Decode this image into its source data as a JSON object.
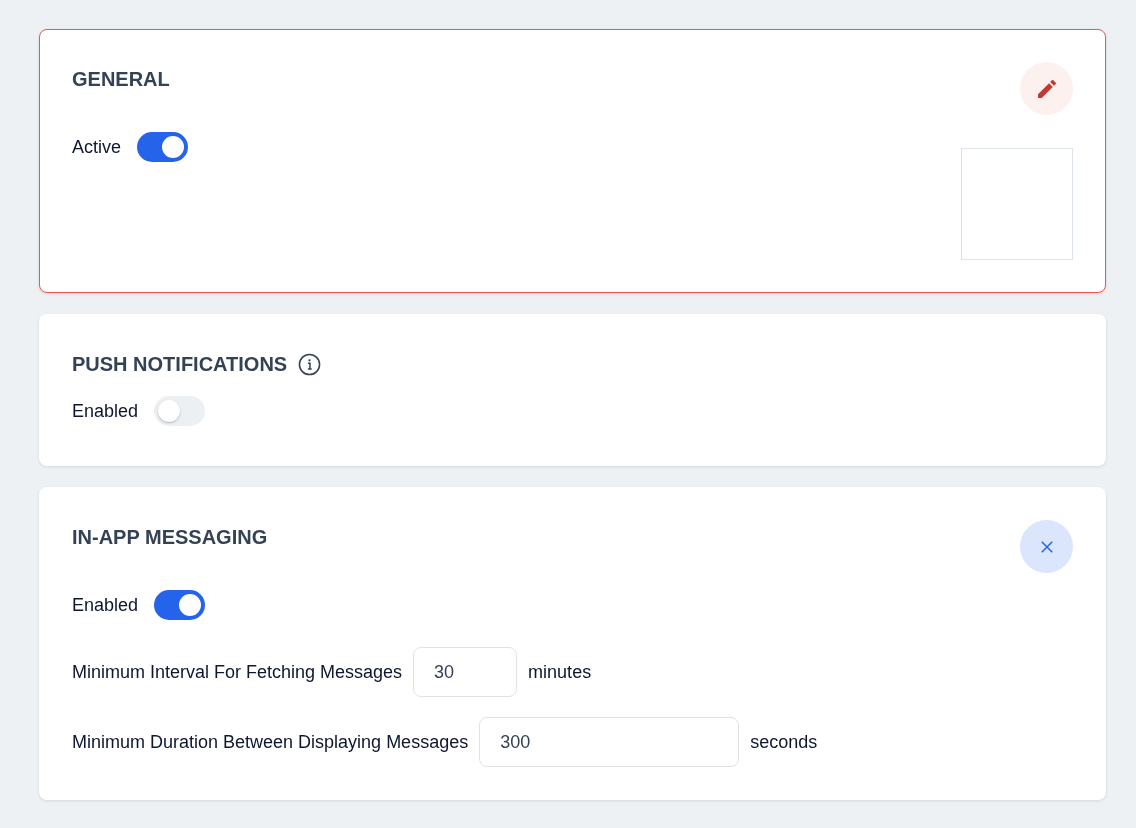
{
  "sections": [
    {
      "title": "GENERAL",
      "selected": true,
      "info_icon": false,
      "edit_button": true,
      "close_button": false,
      "image_frame": true,
      "fields": [
        {
          "kind": "toggle",
          "label": "Active",
          "on": true
        }
      ]
    },
    {
      "title": "PUSH NOTIFICATIONS",
      "selected": false,
      "info_icon": true,
      "edit_button": false,
      "close_button": false,
      "image_frame": false,
      "fields": [
        {
          "kind": "toggle",
          "label": "Enabled",
          "on": false
        }
      ]
    },
    {
      "title": "IN-APP MESSAGING",
      "selected": false,
      "info_icon": false,
      "edit_button": false,
      "close_button": true,
      "image_frame": false,
      "fields": [
        {
          "kind": "toggle",
          "label": "Enabled",
          "on": true
        },
        {
          "kind": "number",
          "label": "Minimum Interval For Fetching Messages",
          "value": "30",
          "unit": "minutes"
        },
        {
          "kind": "number",
          "label": "Minimum Duration Between Displaying Messages",
          "value": "300",
          "unit": "seconds"
        }
      ]
    }
  ]
}
